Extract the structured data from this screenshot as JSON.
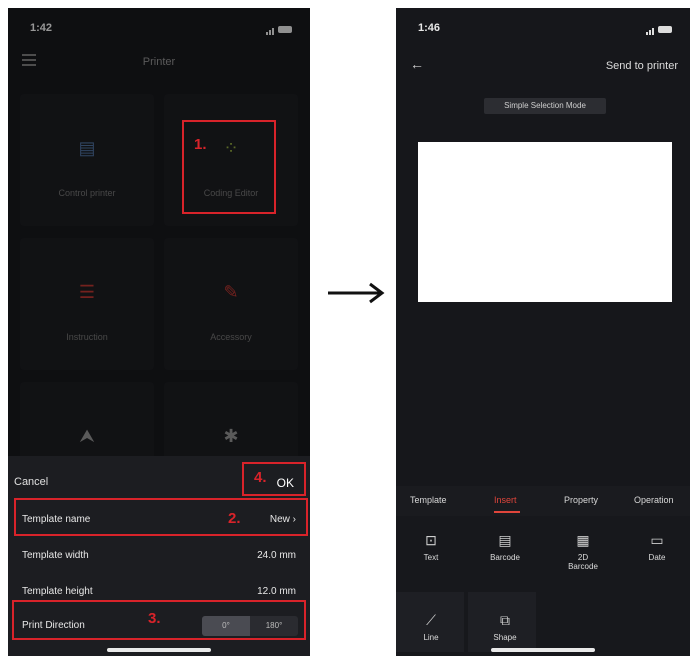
{
  "left_screen": {
    "status_time": "1:42",
    "title": "Printer",
    "tiles": [
      {
        "icon": "printer-icon",
        "glyph": "▤",
        "label": "Control printer",
        "color": "#4a6a96"
      },
      {
        "icon": "coding-editor-icon",
        "glyph": "⁘",
        "label": "Coding Editor",
        "color": "#8aa13c"
      },
      {
        "icon": "instruction-icon",
        "glyph": "☰",
        "label": "Instruction",
        "color": "#b3342e"
      },
      {
        "icon": "accessory-icon",
        "glyph": "✎",
        "label": "Accessory",
        "color": "#b3342e"
      },
      {
        "icon": "upload-icon",
        "glyph": "⮝",
        "label": "",
        "color": "#8a8a8a"
      },
      {
        "icon": "bluetooth-icon",
        "glyph": "✱",
        "label": "",
        "color": "#8a8a8a"
      }
    ],
    "sheet": {
      "cancel": "Cancel",
      "ok": "OK",
      "rows": [
        {
          "label": "Template name",
          "value": "New"
        },
        {
          "label": "Template width",
          "value": "24.0 mm"
        },
        {
          "label": "Template height",
          "value": "12.0 mm"
        }
      ],
      "print_direction": {
        "label": "Print Direction",
        "options": [
          "0°",
          "180°"
        ],
        "selected": "0°"
      }
    },
    "steps": [
      "1.",
      "2.",
      "3.",
      "4."
    ]
  },
  "right_screen": {
    "status_time": "1:46",
    "send_to_printer": "Send to printer",
    "mode_badge": "Simple Selection Mode",
    "tabs": [
      "Template",
      "Insert",
      "Property",
      "Operation"
    ],
    "active_tab": "Insert",
    "tools": [
      {
        "icon": "text-icon",
        "glyph": "⊡",
        "label": "Text"
      },
      {
        "icon": "barcode-icon",
        "glyph": "▤",
        "label": "Barcode"
      },
      {
        "icon": "qr-code-icon",
        "glyph": "▦",
        "label": "2D Barcode"
      },
      {
        "icon": "date-icon",
        "glyph": "▭",
        "label": "Date"
      },
      {
        "icon": "line-icon",
        "glyph": "⟋",
        "label": "Line"
      },
      {
        "icon": "shape-icon",
        "glyph": "⧉",
        "label": "Shape"
      }
    ]
  },
  "accent_color": "#d8232a"
}
